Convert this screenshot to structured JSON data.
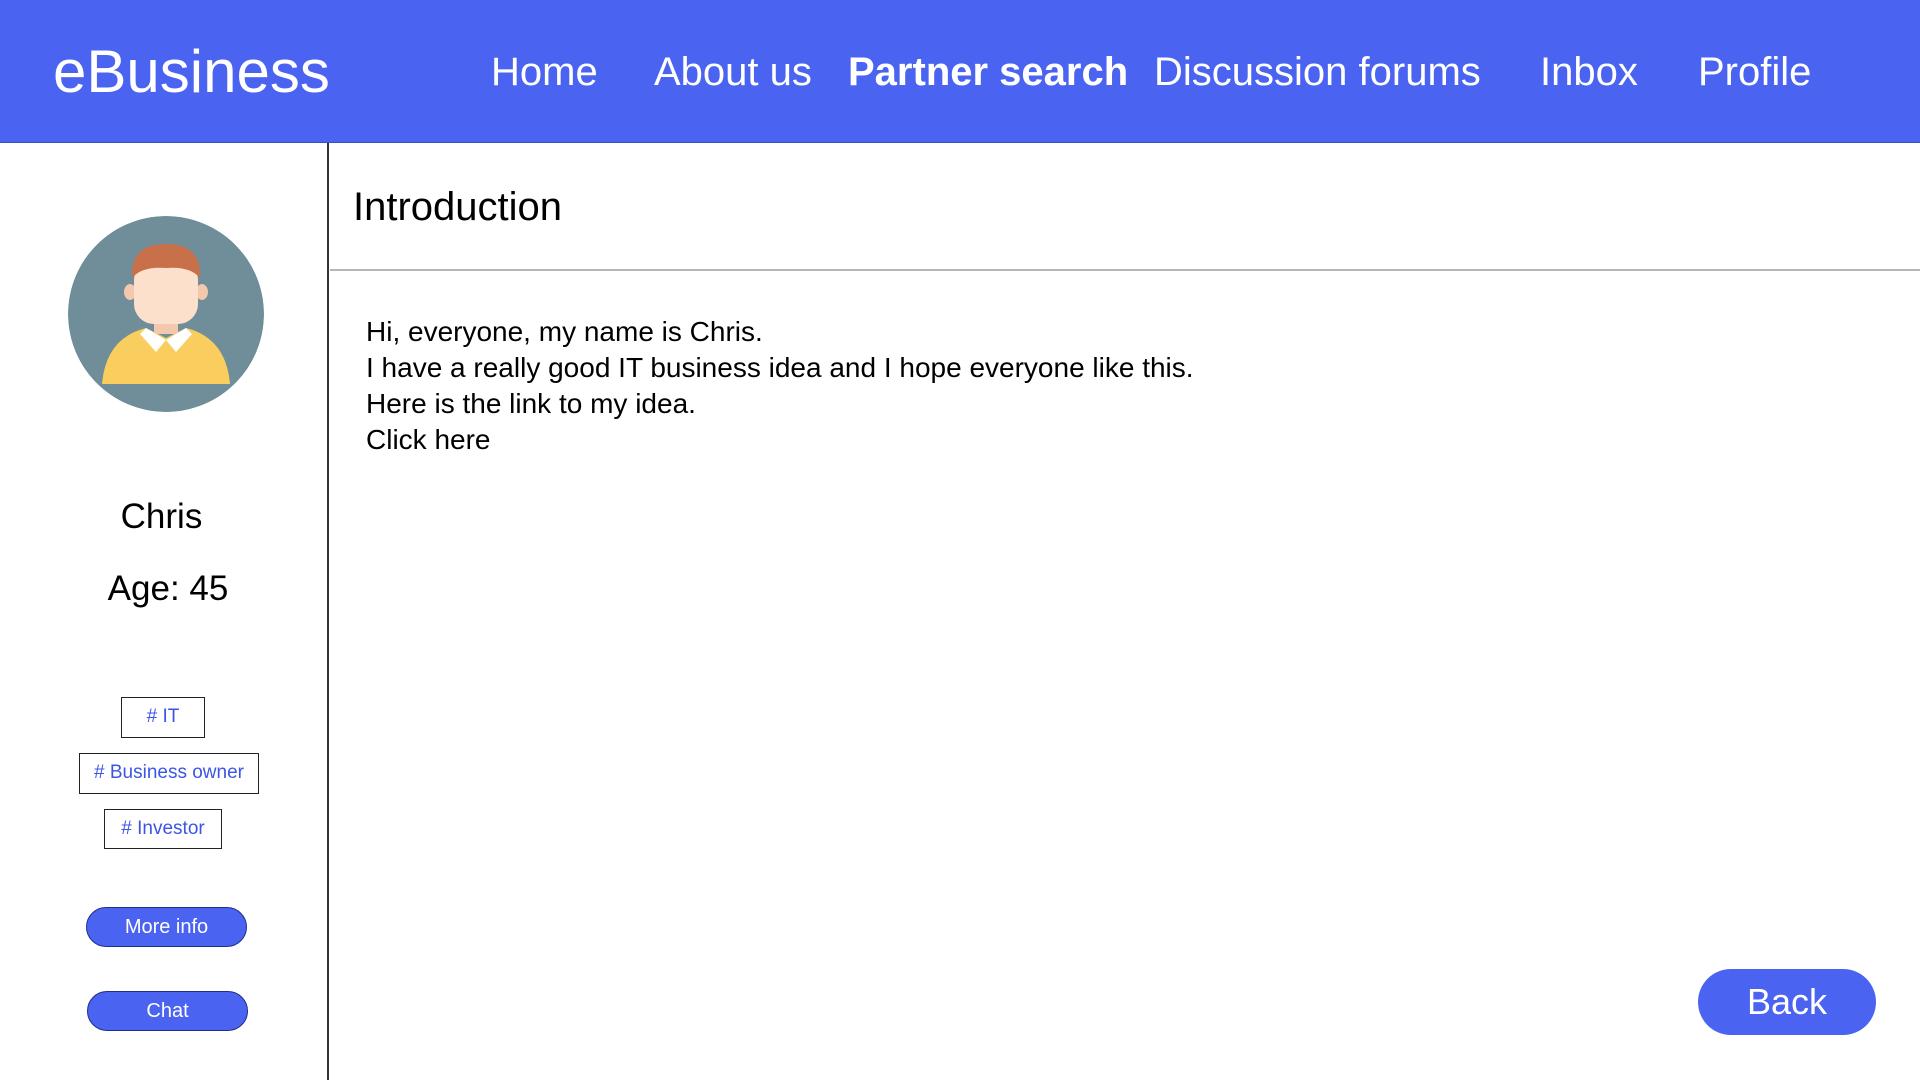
{
  "header": {
    "brand": "eBusiness",
    "nav": [
      {
        "label": "Home"
      },
      {
        "label": "About us"
      },
      {
        "label": "Partner search",
        "active": true
      },
      {
        "label": "Discussion forums"
      },
      {
        "label": "Inbox"
      },
      {
        "label": "Profile"
      }
    ]
  },
  "profile": {
    "name": "Chris",
    "age": "Age: 45",
    "tags": [
      "# IT",
      "# Business owner",
      "# Investor"
    ],
    "more_info_label": "More info",
    "chat_label": "Chat"
  },
  "main": {
    "title": "Introduction",
    "lines": [
      "Hi, everyone, my name is Chris.",
      "I have a really good IT business idea and I hope everyone like this.",
      "Here is the link to my idea.",
      "Click here"
    ],
    "back_label": "Back"
  },
  "colors": {
    "accent": "#4a63f0",
    "tag_text": "#3b56e6",
    "avatar_bg": "#6f8e9a",
    "shirt": "#f9cd5e",
    "hair": "#c8704a",
    "skin": "#fde0cc"
  }
}
